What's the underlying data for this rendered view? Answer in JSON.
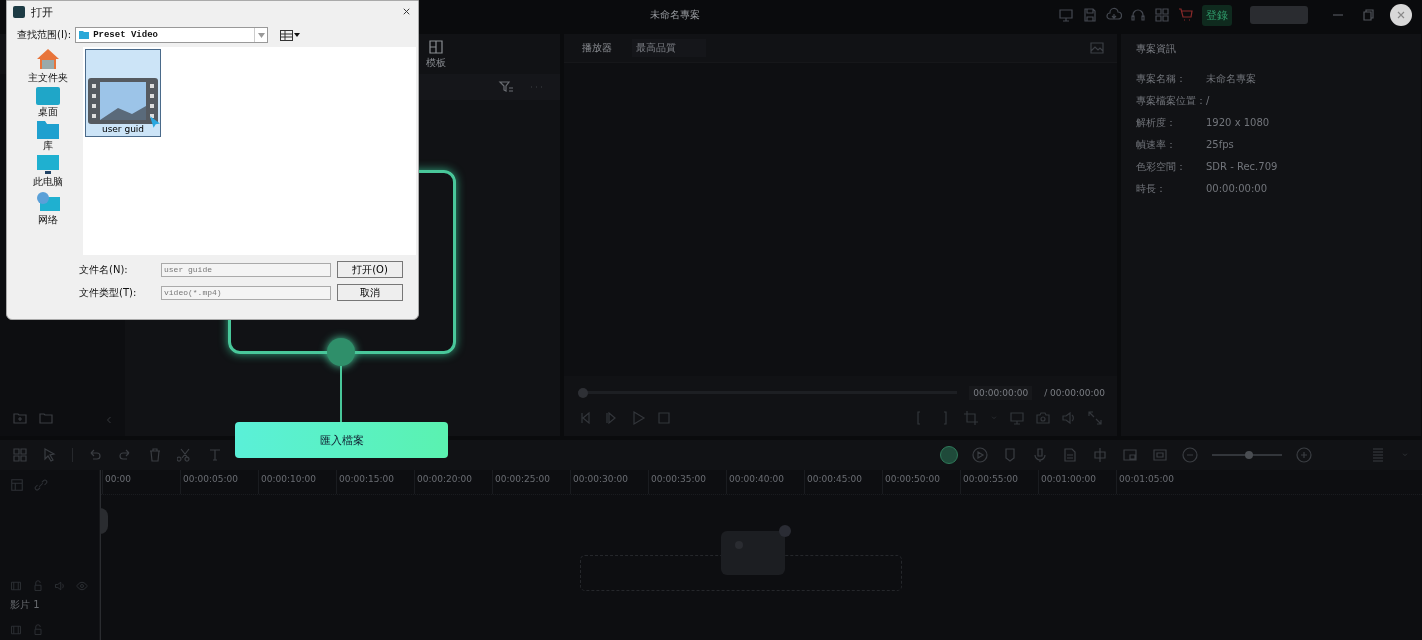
{
  "app": {
    "title": "未命名專案",
    "login_button": "登錄"
  },
  "media_panel": {
    "tab": "模板"
  },
  "player": {
    "title": "播放器",
    "quality": "最高品質",
    "level": 0,
    "current_time": "00:00:00:00",
    "total_time": "/ 00:00:00:00"
  },
  "project_info": {
    "title": "專案資訊",
    "rows": [
      {
        "label": "專案名稱：",
        "value": "未命名專案"
      },
      {
        "label": "專案檔案位置：",
        "value": "/"
      },
      {
        "label": "解析度：",
        "value": "1920 x 1080"
      },
      {
        "label": "幀速率：",
        "value": "25fps"
      },
      {
        "label": "色彩空間：",
        "value": "SDR - Rec.709"
      },
      {
        "label": "時長：",
        "value": "00:00:00:00"
      }
    ]
  },
  "timeline": {
    "zoom": {
      "level": 0.53
    },
    "ruler": [
      "00:00",
      "00:00:05:00",
      "00:00:10:00",
      "00:00:15:00",
      "00:00:20:00",
      "00:00:25:00",
      "00:00:30:00",
      "00:00:35:00",
      "00:00:40:00",
      "00:00:45:00",
      "00:00:50:00",
      "00:00:55:00",
      "00:01:00:00",
      "00:01:05:00"
    ],
    "tracks": [
      {
        "label": "影片 1"
      }
    ]
  },
  "tutorial": {
    "button": "匯入檔案"
  },
  "dialog": {
    "title": "打开",
    "look_in_label": "查找范围(I):",
    "look_in": "Preset Video",
    "places": [
      {
        "label": "主文件夹",
        "kind": "home"
      },
      {
        "label": "桌面",
        "kind": "desktop"
      },
      {
        "label": "库",
        "kind": "library"
      },
      {
        "label": "此电脑",
        "kind": "computer"
      },
      {
        "label": "网络",
        "kind": "network"
      }
    ],
    "files": [
      {
        "name": "user guid",
        "selected": true
      }
    ],
    "file_name_label": "文件名(N):",
    "file_name": "user guide",
    "file_type_label": "文件类型(T):",
    "file_type": "video(*.mp4)",
    "open_button": "打开(O)",
    "cancel_button": "取消"
  }
}
